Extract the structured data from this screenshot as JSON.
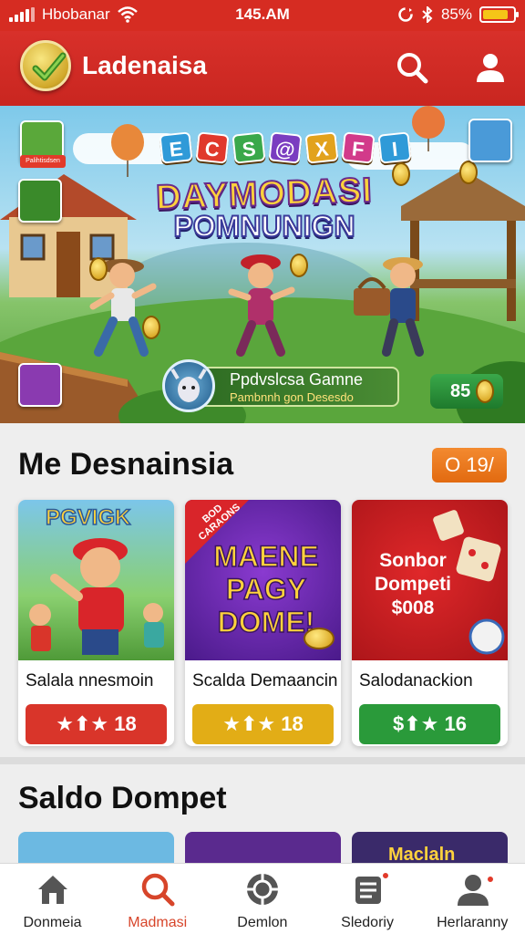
{
  "status_bar": {
    "carrier": "Hbobanar",
    "time": "145.AM",
    "battery": "85%",
    "battery_level": 0.85,
    "icons": [
      "signal-icon",
      "wifi-icon",
      "sync-icon",
      "bluetooth-icon",
      "battery-icon"
    ]
  },
  "app_bar": {
    "title": "Ladenaisa",
    "logo_icon": "check-badge-icon",
    "actions": [
      "search-icon",
      "profile-icon"
    ]
  },
  "banner": {
    "tiles": [
      {
        "char": "E",
        "color": "#2f9ad8"
      },
      {
        "char": "C",
        "color": "#e0392c"
      },
      {
        "char": "S",
        "color": "#3aa84a"
      },
      {
        "char": "@",
        "color": "#7a3cc0"
      },
      {
        "char": "X",
        "color": "#e2a21c"
      },
      {
        "char": "F",
        "color": "#d23a8a"
      },
      {
        "char": "I",
        "color": "#2f9ad8"
      }
    ],
    "title_line1": "DAYMODASI",
    "title_line2": "POMNUNIGN",
    "mini_card_label": "Palihtisdsen",
    "promo_name": "Ppdvslcsa Gamne",
    "promo_sub": "Pambnnh gon Desesdo",
    "coins": "85"
  },
  "section1": {
    "title": "Me Desnainsia",
    "badge": "O 19/",
    "cards": [
      {
        "art_title": "PGVIGK",
        "label": "Salala nnesmoin",
        "button": "★⬆★ 18",
        "button_color": "#d9352a",
        "bg": "#7cc6ea"
      },
      {
        "art_tag": "BOD CARAONS",
        "art_title": "MAENE PAGY DOME!",
        "label": "Scalda Demaancin",
        "button": "★⬆★ 18",
        "button_color": "#e2ad16",
        "bg": "#6a2aa8"
      },
      {
        "art_title": "Sonbor Dompeti $008",
        "label": "Salodanackion",
        "button": "$⬆★ 16",
        "button_color": "#2a9a3a",
        "bg": "#c81e22"
      }
    ]
  },
  "section2": {
    "title": "Saldo Dompet",
    "preview_cards": [
      {
        "bg": "#6cb9e2",
        "art_title": ""
      },
      {
        "bg": "#5a2a8e",
        "art_title": ""
      },
      {
        "bg": "#3a2a6a",
        "art_title": "Maclaln"
      }
    ]
  },
  "bottom_nav": {
    "items": [
      {
        "label": "Donmeia",
        "icon": "home-icon",
        "active": false
      },
      {
        "label": "Madmasi",
        "icon": "search-icon",
        "active": true
      },
      {
        "label": "Demlon",
        "icon": "wallet-icon",
        "active": false
      },
      {
        "label": "Sledoriy",
        "icon": "news-icon",
        "active": false
      },
      {
        "label": "Herlaranny",
        "icon": "profile-icon",
        "active": false
      }
    ]
  },
  "colors": {
    "primary": "#d62c22",
    "active_nav": "#d7452a",
    "badge": "#e26a10"
  }
}
